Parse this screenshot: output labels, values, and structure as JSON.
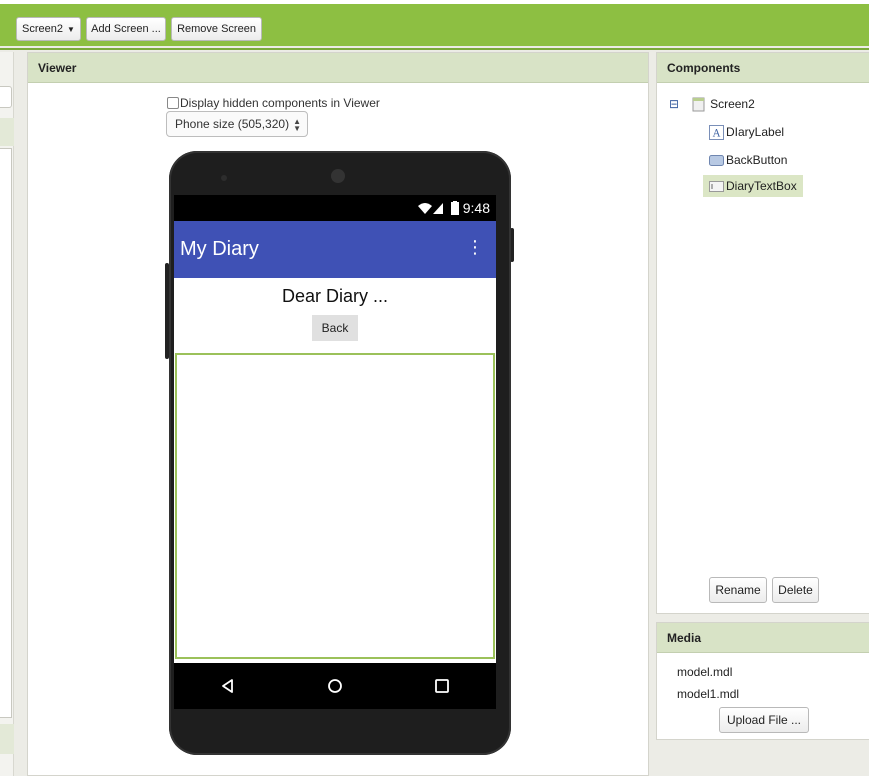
{
  "toolbar": {
    "screen_select": "Screen2",
    "add_screen": "Add Screen ...",
    "remove_screen": "Remove Screen"
  },
  "viewer": {
    "title": "Viewer",
    "hidden_components_label": "Display hidden components in Viewer",
    "phone_size": "Phone size (505,320)"
  },
  "phone": {
    "time": "9:48",
    "app_title": "My Diary",
    "diary_label": "Dear Diary ...",
    "back_button": "Back",
    "menu_icon": "⋮"
  },
  "components": {
    "title": "Components",
    "collapse_icon": "⊟",
    "root": "Screen2",
    "children": [
      "DIaryLabel",
      "BackButton",
      "DiaryTextBox"
    ],
    "selected": "DiaryTextBox",
    "rename_button": "Rename",
    "delete_button": "Delete"
  },
  "media": {
    "title": "Media",
    "files": [
      "model.mdl",
      "model1.mdl"
    ],
    "upload_button": "Upload File ..."
  },
  "colors": {
    "toolbar": "#8dbf42",
    "panel_header": "#d8e3c6",
    "app_bar": "#3f51b5",
    "selection": "#dbe6c5",
    "textbox_border": "#9bc15a"
  }
}
